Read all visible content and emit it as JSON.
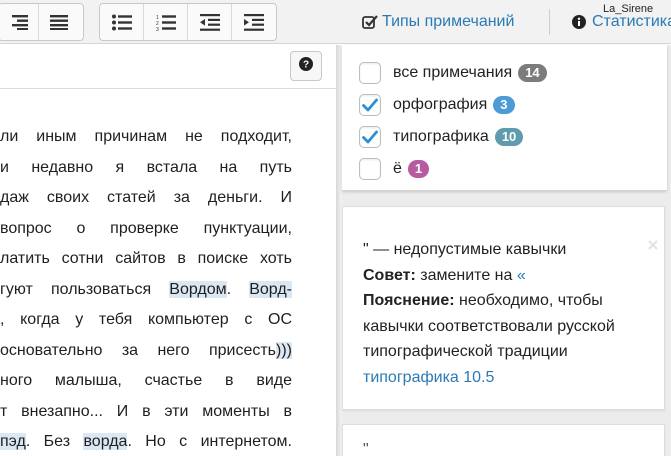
{
  "colors": {
    "accent": "#2a7ab5",
    "badge_all": "#7c7c7c",
    "badge_spelling": "#4a9bd6",
    "badge_typography": "#5f9aad",
    "badge_yo": "#b85aa1",
    "highlight": "#dbe8f3"
  },
  "toolbar": {
    "notes_link": {
      "icon": "checkbox-edit-icon",
      "label": "Типы примечаний"
    },
    "user": "La_Sirene",
    "stats_link": {
      "icon": "info-circle-icon",
      "label": "Статистика"
    },
    "buttons": [
      {
        "icon": "align-right-icon"
      },
      {
        "icon": "align-justify-icon"
      },
      {
        "icon": "bulleted-list-icon"
      },
      {
        "icon": "numbered-list-icon"
      },
      {
        "icon": "outdent-icon"
      },
      {
        "icon": "indent-icon"
      }
    ]
  },
  "editor": {
    "help_icon": "question-circle-icon",
    "lines": [
      {
        "parts": [
          {
            "t": "ли иным причинам не подходит,"
          }
        ]
      },
      {
        "parts": [
          {
            "t": "и  недавно  я  встала  на  путь"
          }
        ]
      },
      {
        "parts": [
          {
            "t": "даж своих статей за деньги. И"
          }
        ]
      },
      {
        "parts": [
          {
            "t": " вопрос о проверке пунктуации,"
          }
        ]
      },
      {
        "parts": [
          {
            "t": "латить сотни сайтов в поиске хоть"
          }
        ]
      },
      {
        "parts": [
          {
            "t": "гуют пользоваться "
          },
          {
            "t": "Вордом",
            "hl": true
          },
          {
            "t": ". "
          },
          {
            "t": "Ворд-",
            "hl": true
          }
        ]
      },
      {
        "parts": [
          {
            "t": ", когда у тебя компьютер с ОС"
          }
        ]
      },
      {
        "parts": [
          {
            "t": " основательно за него присесть"
          },
          {
            "t": ")))",
            "hl": true
          }
        ]
      },
      {
        "parts": [
          {
            "t": "ного  малыша,  счастье  в  виде"
          }
        ]
      },
      {
        "parts": [
          {
            "t": "т внезапно... И в эти моменты в"
          }
        ]
      },
      {
        "parts": [
          {
            "t": "пэд",
            "hl": true
          },
          {
            "t": ". Без "
          },
          {
            "t": "ворда",
            "hl": true
          },
          {
            "t": ". Но с интернетом."
          }
        ]
      }
    ]
  },
  "filters": [
    {
      "label": "все примечания",
      "count": "14",
      "checked": false,
      "color": "#7c7c7c"
    },
    {
      "label": "орфография",
      "count": "3",
      "checked": true,
      "color": "#4a9bd6"
    },
    {
      "label": "типографика",
      "count": "10",
      "checked": true,
      "color": "#5f9aad"
    },
    {
      "label": "ё",
      "count": "1",
      "checked": false,
      "color": "#b85aa1"
    }
  ],
  "card": {
    "title": "\" — недопустимые кавычки",
    "advice_label": "Совет:",
    "advice_text": " замените на ",
    "advice_quote": "«",
    "explain_label": "Пояснение:",
    "explain_text": " необходимо, чтобы кавычки соответствовали русской типографической традиции",
    "rule_link": "типографика 10.5",
    "close_icon": "close-icon"
  },
  "card2": {
    "peek": "\""
  }
}
